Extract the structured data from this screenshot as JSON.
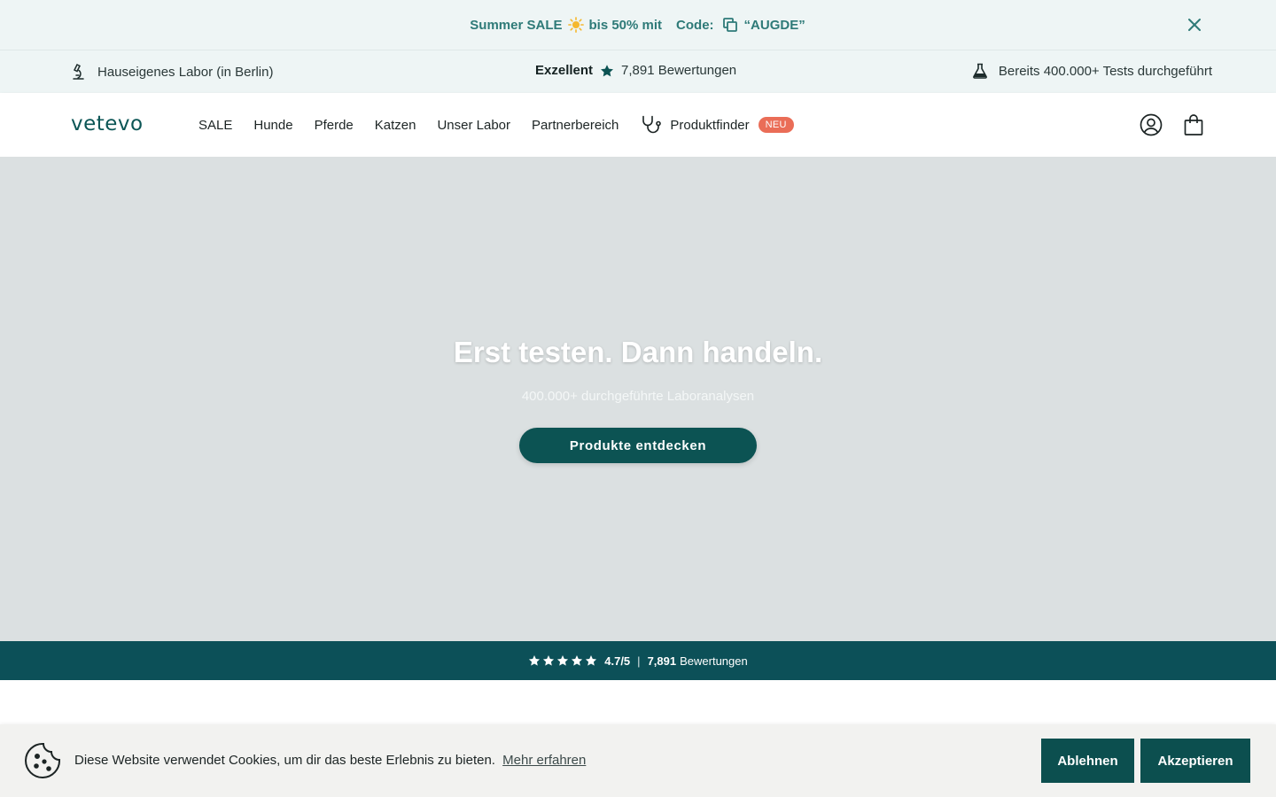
{
  "announcement": {
    "text_before": "Summer SALE",
    "text_after": "bis 50% mit",
    "code_label": "Code:",
    "code_value": "“AUGDE”"
  },
  "usp": {
    "left": "Hauseigenes Labor (in Berlin)",
    "center_bold": "Exzellent",
    "center_reviews": "7,891 Bewertungen",
    "right": "Bereits 400.000+ Tests durchgeführt"
  },
  "header": {
    "logo": "vetevo",
    "nav": {
      "sale": "SALE",
      "hunde": "Hunde",
      "pferde": "Pferde",
      "katzen": "Katzen",
      "labor": "Unser Labor",
      "partner": "Partnerbereich",
      "finder": "Produktfinder",
      "finder_badge": "NEU"
    }
  },
  "hero": {
    "title": "Erst testen. Dann handeln.",
    "subtitle": "400.000+ durchgeführte Laboranalysen",
    "cta": "Produkte entdecken"
  },
  "rating": {
    "score": "4.7/5",
    "separator": "|",
    "count": "7,891",
    "label": "Bewertungen",
    "stars": 5
  },
  "cookie": {
    "text": "Diese Website verwendet Cookies, um dir das beste Erlebnis zu bieten.",
    "link": "Mehr erfahren",
    "decline": "Ablehnen",
    "accept": "Akzeptieren"
  },
  "colors": {
    "brand": "#0c5353",
    "announce_text": "#2e7a78",
    "badge": "#ea6d57",
    "hero_bg": "#dbe0e1"
  }
}
